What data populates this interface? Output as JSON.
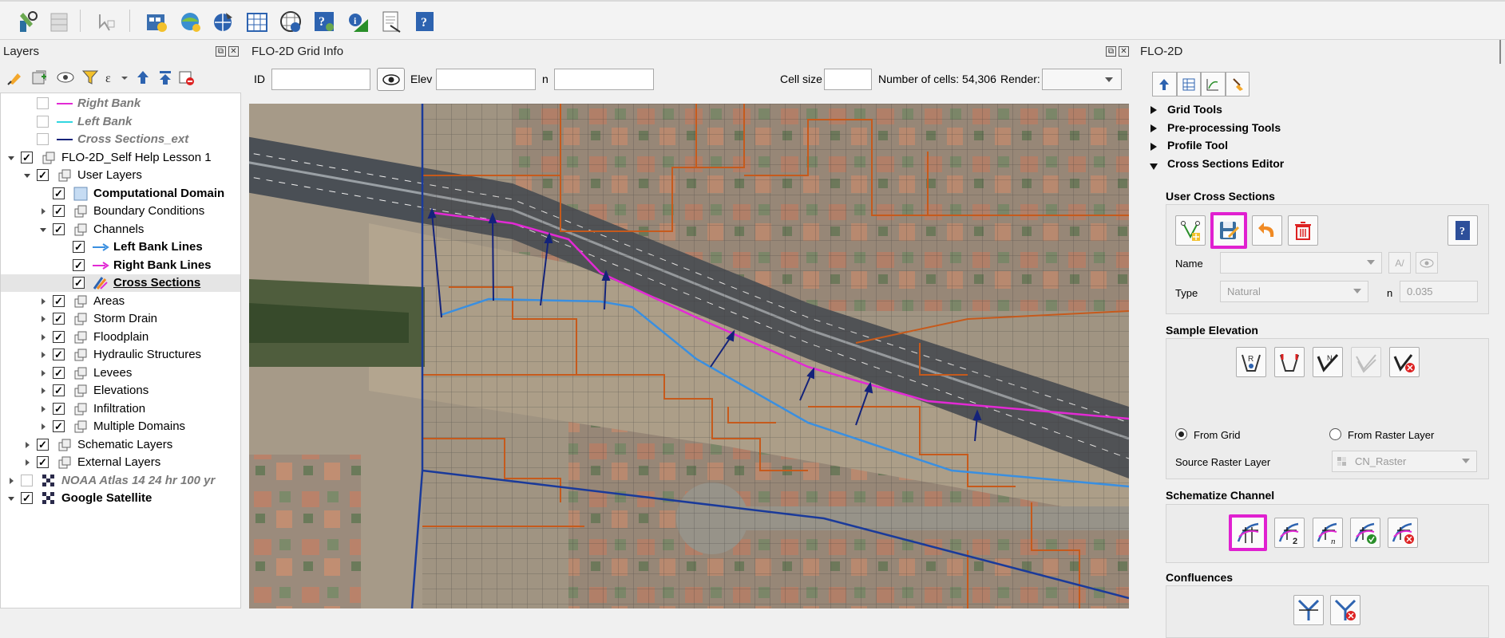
{
  "toolbar": {
    "icons": [
      "flo2d-wrench-icon",
      "grid-table-icon",
      "grid-select-icon",
      "import-gds-icon",
      "import-ras-icon",
      "globe-tool-icon",
      "grid-element-icon",
      "info-tool-icon",
      "cross-section-info-icon",
      "profile-icon",
      "report-icon",
      "help-icon"
    ]
  },
  "layers_panel": {
    "title": "Layers",
    "rows": [
      {
        "label": "Right Bank",
        "style": "ital",
        "checked": false,
        "icon": "magenta-line-icon"
      },
      {
        "label": "Left Bank",
        "style": "ital",
        "checked": false,
        "icon": "cyan-line-icon"
      },
      {
        "label": "Cross Sections_ext",
        "style": "ital",
        "checked": false,
        "icon": "navy-line-icon"
      },
      {
        "label": "FLO-2D_Self Help Lesson 1",
        "style": "normal",
        "checked": true,
        "icon": "group-icon"
      },
      {
        "label": "User Layers",
        "style": "normal",
        "checked": true,
        "icon": "group-icon"
      },
      {
        "label": "Computational Domain",
        "style": "bold",
        "checked": true,
        "icon": "polygon-fill-icon"
      },
      {
        "label": "Boundary Conditions",
        "style": "normal",
        "checked": true,
        "icon": "group-icon"
      },
      {
        "label": "Channels",
        "style": "normal",
        "checked": true,
        "icon": "group-icon"
      },
      {
        "label": "Left Bank Lines",
        "style": "bold",
        "checked": true,
        "icon": "blue-arrow-icon"
      },
      {
        "label": "Right Bank Lines",
        "style": "bold",
        "checked": true,
        "icon": "magenta-arrow-icon"
      },
      {
        "label": "Cross Sections",
        "style": "bold-ul",
        "checked": true,
        "icon": "cross-section-edit-icon"
      },
      {
        "label": "Areas",
        "style": "normal",
        "checked": true,
        "icon": "group-icon"
      },
      {
        "label": "Storm Drain",
        "style": "normal",
        "checked": true,
        "icon": "group-icon"
      },
      {
        "label": "Floodplain",
        "style": "normal",
        "checked": true,
        "icon": "group-icon"
      },
      {
        "label": "Hydraulic Structures",
        "style": "normal",
        "checked": true,
        "icon": "group-icon"
      },
      {
        "label": "Levees",
        "style": "normal",
        "checked": true,
        "icon": "group-icon"
      },
      {
        "label": "Elevations",
        "style": "normal",
        "checked": true,
        "icon": "group-icon"
      },
      {
        "label": "Infiltration",
        "style": "normal",
        "checked": true,
        "icon": "group-icon"
      },
      {
        "label": "Multiple Domains",
        "style": "normal",
        "checked": true,
        "icon": "group-icon"
      },
      {
        "label": "Schematic Layers",
        "style": "normal",
        "checked": true,
        "icon": "group-icon"
      },
      {
        "label": "External Layers",
        "style": "normal",
        "checked": true,
        "icon": "group-icon"
      },
      {
        "label": "NOAA Atlas 14 24 hr 100 yr",
        "style": "ital",
        "checked": false,
        "icon": "raster-icon"
      },
      {
        "label": "Google Satellite",
        "style": "bold",
        "checked": true,
        "icon": "raster-icon"
      }
    ]
  },
  "grid_info": {
    "title": "FLO-2D Grid Info",
    "id_label": "ID",
    "elev_label": "Elev",
    "n_label": "n",
    "cell_size_label": "Cell size",
    "num_cells": "Number of cells: 54,306",
    "render_label": "Render:"
  },
  "flo_panel": {
    "title": "FLO-2D",
    "sections": [
      "Grid Tools",
      "Pre-processing Tools",
      "Profile Tool",
      "Cross Sections Editor"
    ],
    "user_cross_sections": "User Cross Sections",
    "name_label": "Name",
    "type_label": "Type",
    "type_value": "Natural",
    "n_label": "n",
    "n_value": "0.035",
    "sample_elevation": "Sample Elevation",
    "from_grid": "From Grid",
    "from_raster": "From Raster Layer",
    "source_raster_label": "Source Raster Layer",
    "source_raster_value": "CN_Raster",
    "schematize_channel": "Schematize Channel",
    "confluences": "Confluences"
  },
  "colors": {
    "highlight": "#e020d0",
    "right_bank": "#e22ad4",
    "left_bank": "#3a8fe0",
    "cross_section": "#14237a",
    "domain": "#1a3a9a",
    "grid_outline": "#c65a1c"
  }
}
